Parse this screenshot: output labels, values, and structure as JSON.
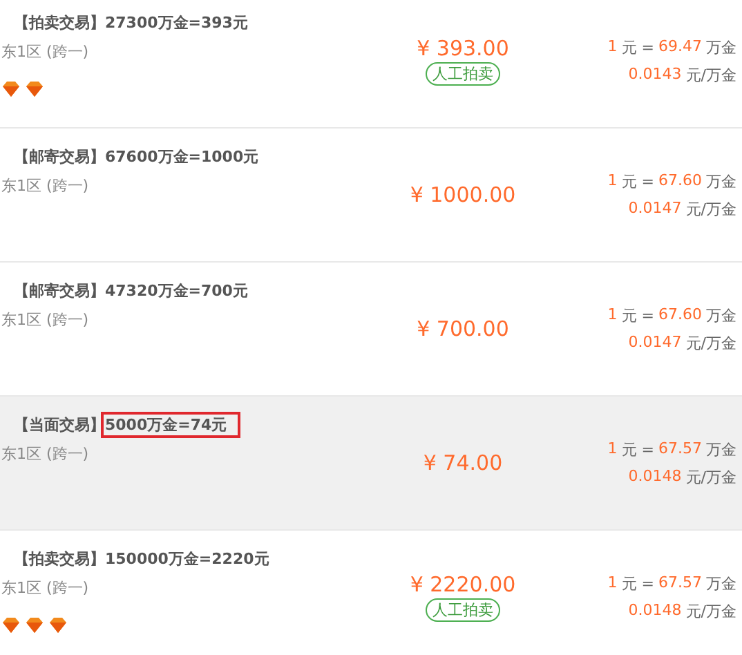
{
  "listings": [
    {
      "trade_type": "【拍卖交易】",
      "title": "27300万金=393元",
      "marked": false,
      "server": "东1区 (跨一)",
      "rank_icons": [
        {
          "kind": "diamond"
        },
        {
          "kind": "diamond"
        }
      ],
      "price": "¥ 393.00",
      "badge": "人工拍卖",
      "selected": false,
      "rate": {
        "yuan": "1",
        "eq": "元 =",
        "amount": "69.47",
        "unit": "万金"
      },
      "per": {
        "value": "0.0143",
        "unit": "元/万金"
      }
    },
    {
      "trade_type": "【邮寄交易】",
      "title": "67600万金=1000元",
      "marked": false,
      "server": "东1区 (跨一)",
      "price": "¥ 1000.00",
      "selected": false,
      "rate": {
        "yuan": "1",
        "eq": "元 =",
        "amount": "67.60",
        "unit": "万金"
      },
      "per": {
        "value": "0.0147",
        "unit": "元/万金"
      }
    },
    {
      "trade_type": "【邮寄交易】",
      "title": "47320万金=700元",
      "marked": false,
      "server": "东1区 (跨一)",
      "price": "¥ 700.00",
      "selected": false,
      "rate": {
        "yuan": "1",
        "eq": "元 =",
        "amount": "67.60",
        "unit": "万金"
      },
      "per": {
        "value": "0.0147",
        "unit": "元/万金"
      }
    },
    {
      "trade_type": "【当面交易】",
      "title": "5000万金=74元",
      "marked": true,
      "server": "东1区 (跨一)",
      "price": "¥ 74.00",
      "selected": true,
      "rate": {
        "yuan": "1",
        "eq": "元 =",
        "amount": "67.57",
        "unit": "万金"
      },
      "per": {
        "value": "0.0148",
        "unit": "元/万金"
      }
    },
    {
      "trade_type": "【拍卖交易】",
      "title": "150000万金=2220元",
      "marked": false,
      "server": "东1区 (跨一)",
      "rank_icons": [
        {
          "kind": "diamond"
        },
        {
          "kind": "diamond"
        },
        {
          "kind": "diamond"
        }
      ],
      "price": "¥ 2220.00",
      "badge": "人工拍卖",
      "selected": false,
      "rate": {
        "yuan": "1",
        "eq": "元 =",
        "amount": "67.57",
        "unit": "万金"
      },
      "per": {
        "value": "0.0148",
        "unit": "元/万金"
      }
    }
  ]
}
